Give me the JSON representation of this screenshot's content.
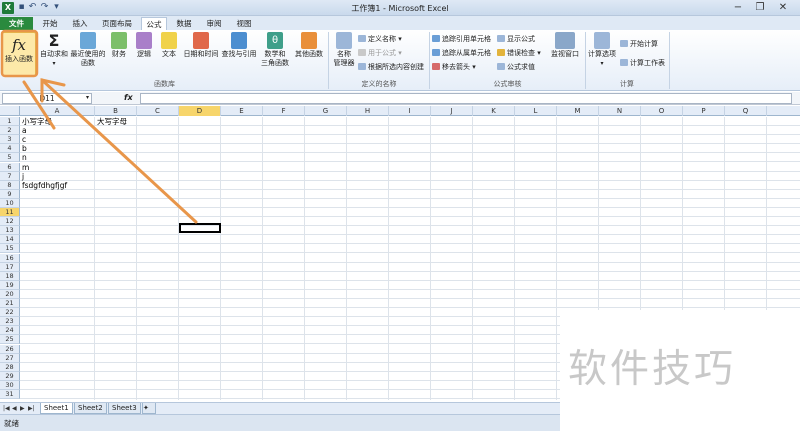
{
  "titlebar": {
    "title": "工作簿1 - Microsoft Excel",
    "logo": "X",
    "qat_icons": [
      "save-icon",
      "undo-icon",
      "redo-icon",
      "customize-icon"
    ]
  },
  "tabs": [
    "文件",
    "开始",
    "插入",
    "页面布局",
    "公式",
    "数据",
    "审阅",
    "视图"
  ],
  "active_tab": "公式",
  "ribbon": {
    "insert_function": "插入函数",
    "autosum": "自动求和",
    "recent": [
      "最近使用的",
      "函数"
    ],
    "financial": "财务",
    "logical": "逻辑",
    "text": "文本",
    "datetime": "日期和时间",
    "lookup": "查找与引用",
    "math": [
      "数学和",
      "三角函数"
    ],
    "more": "其他函数",
    "library_group": "函数库",
    "name_manager": [
      "名称",
      "管理器"
    ],
    "define_name": "定义名称",
    "use_in_formula": "用于公式",
    "create_from_selection": "根据所选内容创建",
    "names_group": "定义的名称",
    "trace_precedents": "追踪引用单元格",
    "trace_dependents": "追踪从属单元格",
    "remove_arrows": "移去箭头",
    "show_formulas": "显示公式",
    "error_checking": "错误检查",
    "evaluate_formula": "公式求值",
    "watch_window": "监视窗口",
    "audit_group": "公式审核",
    "calc_options": "计算选项",
    "calc_now": "开始计算",
    "calc_sheet": "计算工作表",
    "calc_group": "计算"
  },
  "formula_bar": {
    "name_box": "D11",
    "fx_label": "fx",
    "value": ""
  },
  "columns": [
    "A",
    "B",
    "C",
    "D",
    "E",
    "F",
    "G",
    "H",
    "I",
    "J",
    "K",
    "L",
    "M",
    "N",
    "O",
    "P",
    "Q"
  ],
  "selected_column": "D",
  "rows": [
    "1",
    "2",
    "3",
    "4",
    "5",
    "6",
    "7",
    "8",
    "9",
    "10",
    "11",
    "12",
    "13",
    "14",
    "15",
    "16",
    "17",
    "18",
    "19",
    "20",
    "21",
    "22",
    "23",
    "24",
    "25",
    "26",
    "27",
    "28",
    "29",
    "30",
    "31"
  ],
  "selected_row": "11",
  "cells": {
    "A1": "小写字母",
    "B1": "大写字母",
    "A2": "a",
    "A3": "c",
    "A4": "b",
    "A5": "n",
    "A6": "m",
    "A7": "j",
    "A8": "fsdgfdhgfjgf"
  },
  "sheets": [
    "Sheet1",
    "Sheet2",
    "Sheet3"
  ],
  "active_sheet": "Sheet1",
  "status": "就绪",
  "watermark": "软件技巧",
  "colors": {
    "file_tab": "#2a8a3e",
    "highlight": "#f7d56b",
    "annotation": "#e8964a"
  }
}
